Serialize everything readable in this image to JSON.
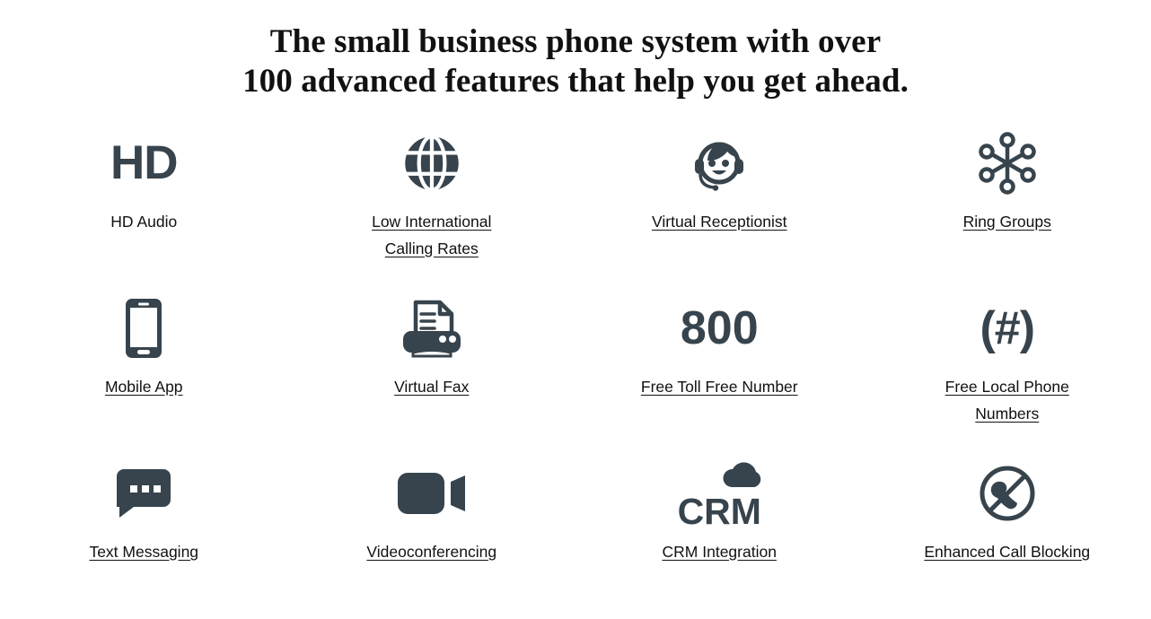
{
  "headline": "The small business phone system with over\n100 advanced features that help you get ahead.",
  "colors": {
    "icon": "#37444d",
    "text": "#111111",
    "background": "#ffffff"
  },
  "features": [
    {
      "id": "hd-audio",
      "label": "HD Audio",
      "icon": "hd-text-icon",
      "icon_text": "HD",
      "underlined": false
    },
    {
      "id": "low-international-calling-rates",
      "label": "Low International Calling Rates",
      "icon": "globe-icon",
      "underlined": true
    },
    {
      "id": "virtual-receptionist",
      "label": "Virtual Receptionist",
      "icon": "headset-face-icon",
      "underlined": true
    },
    {
      "id": "ring-groups",
      "label": "Ring Groups",
      "icon": "hub-spoke-icon",
      "underlined": true
    },
    {
      "id": "mobile-app",
      "label": "Mobile App",
      "icon": "smartphone-icon",
      "underlined": true
    },
    {
      "id": "virtual-fax",
      "label": "Virtual Fax",
      "icon": "fax-printer-icon",
      "underlined": true
    },
    {
      "id": "free-toll-free-number",
      "label": "Free Toll Free Number",
      "icon": "800-text-icon",
      "icon_text": "800",
      "underlined": true
    },
    {
      "id": "free-local-phone-numbers",
      "label": "Free Local Phone Numbers",
      "icon": "hash-parens-text-icon",
      "icon_text": "(#)",
      "underlined": true
    },
    {
      "id": "text-messaging",
      "label": "Text Messaging",
      "icon": "speech-bubble-icon",
      "underlined": true
    },
    {
      "id": "videoconferencing",
      "label": "Videoconferencing",
      "icon": "video-camera-icon",
      "underlined": true
    },
    {
      "id": "crm-integration",
      "label": "CRM Integration",
      "icon": "crm-cloud-text-icon",
      "icon_text": "CRM",
      "underlined": true
    },
    {
      "id": "enhanced-call-blocking",
      "label": "Enhanced Call Blocking",
      "icon": "no-phone-icon",
      "underlined": true
    }
  ]
}
